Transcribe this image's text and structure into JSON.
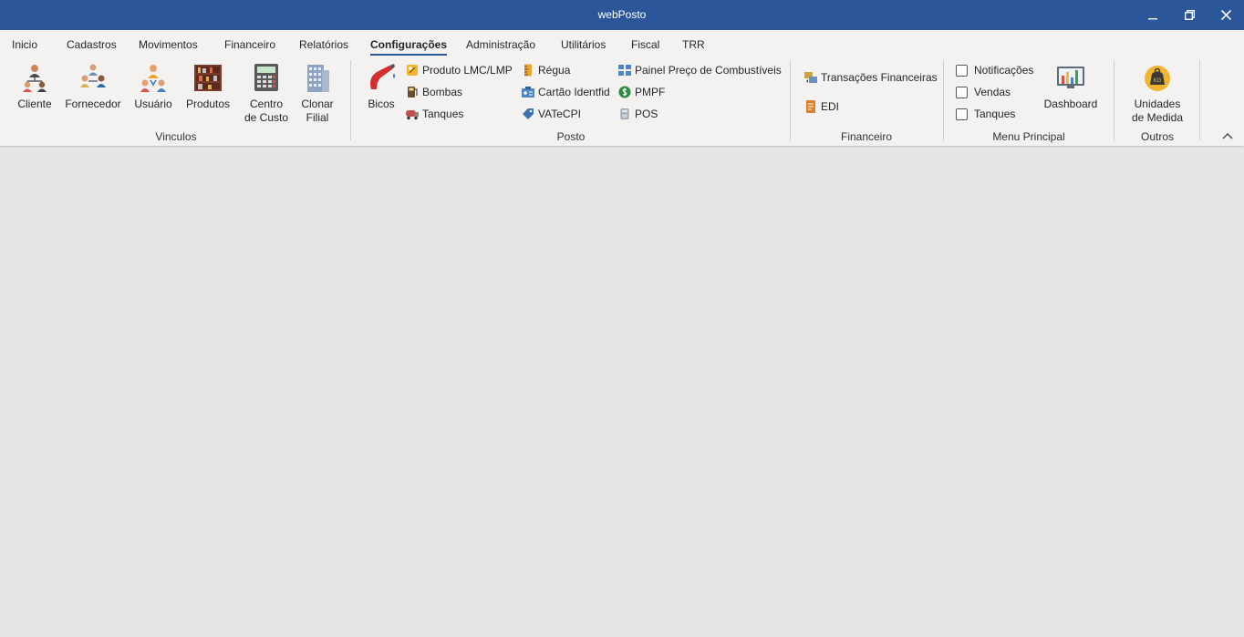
{
  "window": {
    "title": "webPosto"
  },
  "menu": {
    "tabs": [
      {
        "label": "Inicio"
      },
      {
        "label": "Cadastros"
      },
      {
        "label": "Movimentos"
      },
      {
        "label": "Financeiro"
      },
      {
        "label": "Relatórios"
      },
      {
        "label": "Configurações",
        "active": true
      },
      {
        "label": "Administração"
      },
      {
        "label": "Utilitários"
      },
      {
        "label": "Fiscal"
      },
      {
        "label": "TRR"
      }
    ]
  },
  "ribbon": {
    "vinculos": {
      "label": "Vinculos",
      "cliente": "Cliente",
      "fornecedor": "Fornecedor",
      "usuario": "Usuário",
      "produtos": "Produtos",
      "centro_custo_1": "Centro",
      "centro_custo_2": "de Custo",
      "clonar_filial_1": "Clonar",
      "clonar_filial_2": "Filial"
    },
    "posto": {
      "label": "Posto",
      "bicos": "Bicos",
      "produto_lmc": "Produto LMC/LMP",
      "bombas": "Bombas",
      "tanques": "Tanques",
      "regua": "Régua",
      "cartao": "Cartão Identfid",
      "vatecpi": "VATeCPI",
      "painel": "Painel Preço de Combustíveis",
      "pmpf": "PMPF",
      "pos": "POS"
    },
    "financeiro": {
      "label": "Financeiro",
      "transacoes": "Transações Financeiras",
      "edi": "EDI"
    },
    "menu_principal": {
      "label": "Menu Principal",
      "notificacoes": "Notificações",
      "vendas": "Vendas",
      "tanques": "Tanques",
      "dashboard": "Dashboard"
    },
    "outros": {
      "label": "Outros",
      "unidades_1": "Unidades",
      "unidades_2": "de Medida"
    }
  },
  "colors": {
    "titlebar": "#2b579a",
    "ribbon": "#f3f2f1",
    "workspace": "#e6e6e6"
  }
}
